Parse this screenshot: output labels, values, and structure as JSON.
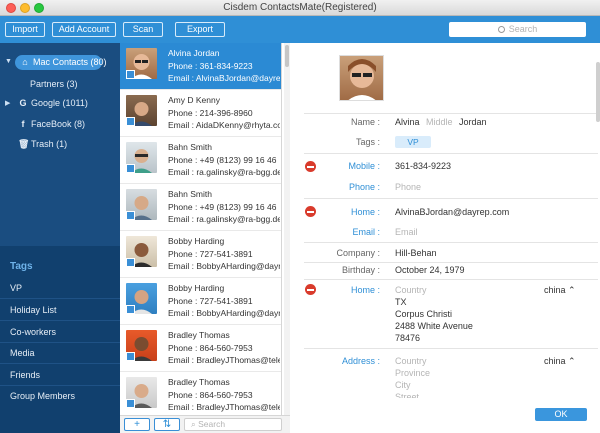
{
  "window": {
    "title": "Cisdem ContactsMate(Registered)"
  },
  "toolbar": {
    "import": "Import",
    "add_account": "Add Account",
    "scan": "Scan",
    "export": "Export",
    "search_placeholder": "Search"
  },
  "sources": {
    "mac": "Mac Contacts (80)",
    "partners": "Partners (3)",
    "google": "Google (1011)",
    "facebook": "FaceBook (8)",
    "trash": "Trash (1)"
  },
  "tags": {
    "heading": "Tags",
    "items": [
      "VP",
      "Holiday List",
      "Co-workers",
      "Media",
      "Friends",
      "Group Members"
    ]
  },
  "contacts": [
    {
      "name": "Alvina Jordan",
      "phone": "Phone : 361-834-9223",
      "email": "Email : AlvinaBJordan@dayrep.com",
      "selected": true
    },
    {
      "name": "Amy D Kenny",
      "phone": "Phone : 214-396-8960",
      "email": "Email : AidaDKenny@rhyta.com"
    },
    {
      "name": "Bahn Smith",
      "phone": "Phone : +49 (8123) 99 16 46",
      "email": "Email : ra.galinsky@ra-bgg.de"
    },
    {
      "name": "Bahn Smith",
      "phone": "Phone : +49 (8123) 99 16 46",
      "email": "Email : ra.galinsky@ra-bgg.de"
    },
    {
      "name": "Bobby Harding",
      "phone": "Phone : 727-541-3891",
      "email": "Email : BobbyAHarding@dayrep.com"
    },
    {
      "name": "Bobby Harding",
      "phone": "Phone : 727-541-3891",
      "email": "Email : BobbyAHarding@dayrep.com"
    },
    {
      "name": "Bradley Thomas",
      "phone": "Phone : 864-560-7953",
      "email": "Email : BradleyJThomas@teleworm.us"
    },
    {
      "name": "Bradley Thomas",
      "phone": "Phone : 864-560-7953",
      "email": "Email : BradleyJThomas@teleworm.us"
    }
  ],
  "list_footer": {
    "add": "+",
    "sort": "⇅",
    "search_placeholder": "Search"
  },
  "detail": {
    "name_label": "Name :",
    "first": "Alvina",
    "middle_placeholder": "Middle",
    "last": "Jordan",
    "tags_label": "Tags :",
    "tag": "VP",
    "mobile_label": "Mobile :",
    "mobile": "361-834-9223",
    "phone_label": "Phone :",
    "phone_placeholder": "Phone",
    "home_email_label": "Home :",
    "home_email": "AlvinaBJordan@dayrep.com",
    "email_label": "Email :",
    "email_placeholder": "Email",
    "company_label": "Company :",
    "company": "Hill-Behan",
    "birthday_label": "Birthday :",
    "birthday": "October 24, 1979",
    "home_addr_label": "Home :",
    "addr_country_placeholder": "Country",
    "addr_line1": "TX",
    "addr_line2": "Corpus Christi",
    "addr_line3": "2488 White Avenue",
    "addr_line4": "78476",
    "addr_country": "china",
    "address_label": "Address :",
    "addr2_country_placeholder": "Country",
    "addr2_province_placeholder": "Province",
    "addr2_city_placeholder": "City",
    "addr2_street_placeholder": "Street",
    "addr2_country": "china",
    "ok": "OK"
  },
  "colors": {
    "accent": "#2f8fd6",
    "sidebar": "#11406e",
    "selection": "#2b8ad4"
  }
}
